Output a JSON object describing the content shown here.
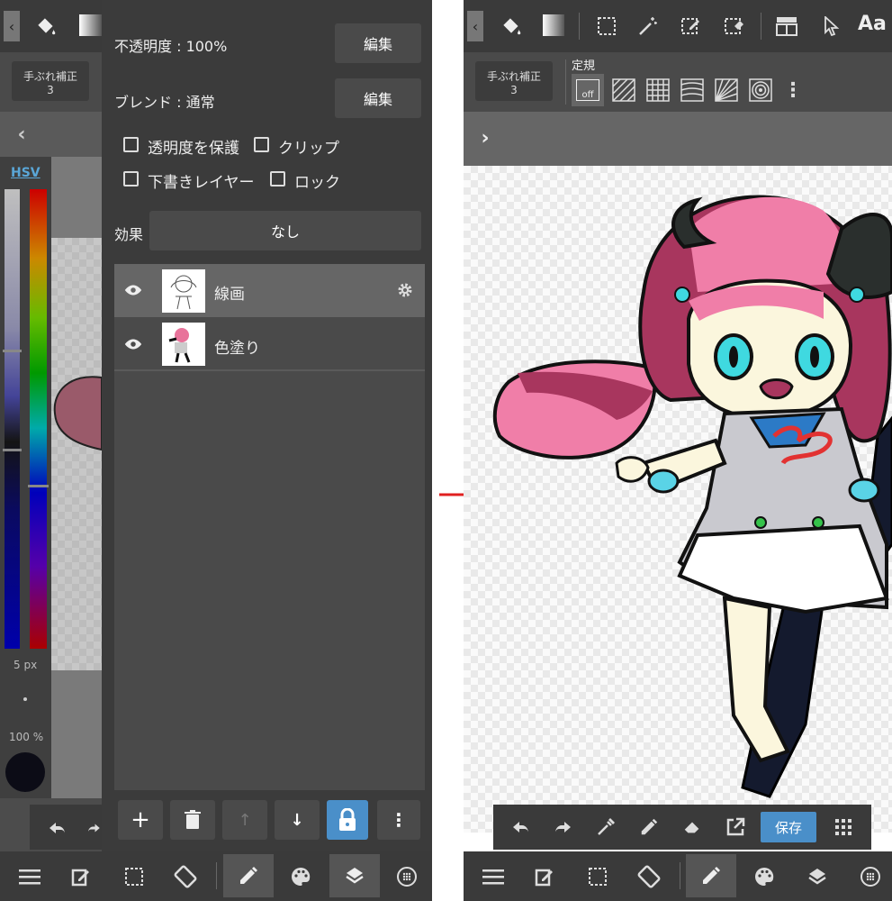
{
  "left": {
    "stabilizer": {
      "label": "手ぶれ補正",
      "value": "3"
    },
    "color_mode": "HSV",
    "brush_size": "5 px",
    "brush_opacity": "100 %",
    "layer_panel": {
      "opacity_label": "不透明度 : 100%",
      "blend_label": "ブレンド : 通常",
      "edit_label": "編集",
      "protect_alpha": "透明度を保護",
      "clip": "クリップ",
      "draft_layer": "下書きレイヤー",
      "lock": "ロック",
      "effect_label": "効果",
      "effect_value": "なし",
      "layers": [
        {
          "name": "線画"
        },
        {
          "name": "色塗り"
        }
      ]
    }
  },
  "right": {
    "stabilizer": {
      "label": "手ぶれ補正",
      "value": "3"
    },
    "ruler_label": "定規",
    "ruler_off": "off",
    "text_tool": "Aa",
    "save_label": "保存"
  },
  "colors": {
    "accent": "#4a8fc9",
    "panel": "#3b3b3b",
    "arrow": "#e02020"
  }
}
